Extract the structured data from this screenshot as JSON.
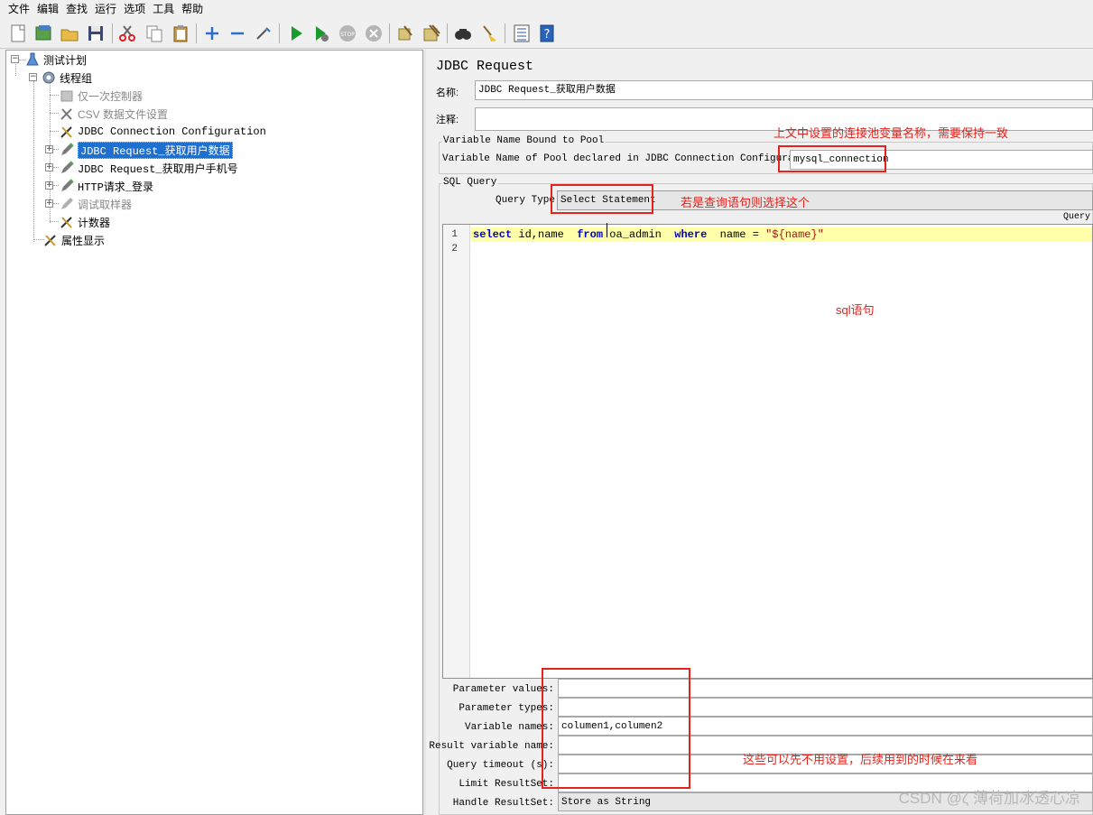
{
  "menu": [
    "文件",
    "编辑",
    "查找",
    "运行",
    "选项",
    "工具",
    "帮助"
  ],
  "toolbar_icons": [
    "new-icon",
    "templates-icon",
    "open-icon",
    "save-icon",
    "cut-icon",
    "copy-icon",
    "paste-icon",
    "expand-icon",
    "collapse-icon",
    "toggle-icon",
    "start-icon",
    "start-no-pause-icon",
    "stop-icon",
    "shutdown-icon",
    "clear-icon",
    "clear-all-icon",
    "search-icon",
    "reset-search-icon",
    "function-helper-icon",
    "help-icon"
  ],
  "tree": {
    "test_plan": "测试计划",
    "thread_group": "线程组",
    "items": [
      {
        "label": "仅一次控制器",
        "icon": "controller-icon",
        "disabled": true,
        "selected": false
      },
      {
        "label": "CSV 数据文件设置",
        "icon": "config-wrench-icon",
        "disabled": true,
        "selected": false
      },
      {
        "label": "JDBC Connection Configuration",
        "icon": "config-wrench-icon",
        "disabled": false,
        "selected": false
      },
      {
        "label": "JDBC Request_获取用户数据",
        "icon": "sampler-pen-icon",
        "disabled": false,
        "selected": true
      },
      {
        "label": "JDBC Request_获取用户手机号",
        "icon": "sampler-pen-icon",
        "disabled": false,
        "selected": false
      },
      {
        "label": "HTTP请求_登录",
        "icon": "sampler-pen-icon",
        "disabled": false,
        "selected": false
      },
      {
        "label": "调试取样器",
        "icon": "sampler-pen-icon",
        "disabled": true,
        "selected": false
      },
      {
        "label": "计数器",
        "icon": "config-wrench-icon",
        "disabled": false,
        "selected": false
      }
    ],
    "property_display": "属性显示"
  },
  "panel": {
    "title": "JDBC Request",
    "name_label": "名称:",
    "name_value": "JDBC Request_获取用户数据",
    "comment_label": "注释:",
    "comment_value": "",
    "pool_group_title": "Variable Name Bound to Pool",
    "pool_label": "Variable Name of Pool declared in JDBC Connection Configuration:",
    "pool_value": "mysql_connection",
    "sql_group_title": "SQL Query",
    "query_type_label": "Query Type:",
    "query_type_value": "Select Statement",
    "query_header": "Query",
    "line_numbers": [
      "1",
      "2"
    ],
    "code": {
      "select": "select",
      "cols": " id,name  ",
      "from": "from",
      "table": " oa_admin  ",
      "where": "where",
      "cond": "  name = ",
      "string": "\"${name}\""
    },
    "params": [
      {
        "label": "Parameter values:",
        "value": ""
      },
      {
        "label": "Parameter types:",
        "value": ""
      },
      {
        "label": "Variable names:",
        "value": "columen1,columen2"
      },
      {
        "label": "Result variable name:",
        "value": ""
      },
      {
        "label": "Query timeout (s):",
        "value": ""
      },
      {
        "label": "Limit ResultSet:",
        "value": ""
      },
      {
        "label": "Handle ResultSet:",
        "value": "Store as String"
      }
    ]
  },
  "annotations": {
    "pool_note": "上文中设置的连接池变量名称，需要保持一致",
    "query_type_note": "若是查询语句则选择这个",
    "sql_note": "sql语句",
    "params_note": "这些可以先不用设置，后续用到的时候在来看"
  },
  "watermark": "CSDN @ζ 薄荷加冰透心凉",
  "colors": {
    "annotation_red": "#e8221b",
    "selection_blue": "#1f6fce",
    "current_line": "#ffffaa",
    "keyword": "#0000cc"
  }
}
